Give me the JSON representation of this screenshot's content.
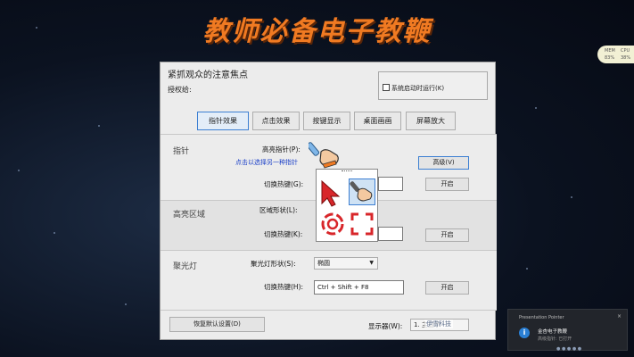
{
  "banner": {
    "title": "教师必备电子教鞭"
  },
  "dialog": {
    "title": "紧抓观众的注意焦点",
    "author_label": "授权给:",
    "startup_label": "系统启动时运行(K)",
    "tabs": [
      {
        "label": "指针效果",
        "active": true
      },
      {
        "label": "点击效果"
      },
      {
        "label": "按键显示"
      },
      {
        "label": "桌面画画"
      },
      {
        "label": "屏幕放大"
      }
    ],
    "pointer": {
      "section_title": "指针",
      "highlight_label": "高亮指针(P):",
      "select_link": "点击以选择另一种指针",
      "advanced_button": "高级(V)",
      "hotkey_label": "切换热键(G):",
      "hotkey_value": "",
      "toggle_button": "开启"
    },
    "highlight_area": {
      "section_title": "高亮区域",
      "shape_label": "区域形状(L):",
      "hotkey_label": "切换热键(K):",
      "hotkey_value": "",
      "toggle_button": "开启"
    },
    "spotlight": {
      "section_title": "聚光灯",
      "shape_label": "聚光灯形状(S):",
      "shape_value": "椭圆",
      "hotkey_label": "切换热键(H):",
      "hotkey_value": "Ctrl + Shift + F8",
      "toggle_button": "开启"
    },
    "footer": {
      "reset_button": "恢复默认设置(D)",
      "display_label": "显示器(W):",
      "display_value": "1. 主显示"
    }
  },
  "watermark": {
    "text": "伊雪科技"
  },
  "cpu_widget": {
    "left_label": "MEM",
    "left_value": "83%",
    "right_label": "CPU",
    "right_value": "38%"
  },
  "toast": {
    "app_name": "Presentation Pointer",
    "close": "×",
    "line1": "金杏电子教鞭",
    "line2": "高级指针: 已打开"
  },
  "icons": {
    "pointer_hand": "hand-pointer-icon",
    "arrow_cursor": "red-arrow-cursor-icon",
    "target": "target-ring-icon",
    "corner_frame": "corner-frame-icon",
    "info": "info-icon"
  },
  "colors": {
    "banner": "#f07a22",
    "accent": "#3c7fd2",
    "link": "#1a3fc8",
    "icon_red": "#d8262a",
    "toast_info": "#2a7fd4"
  }
}
